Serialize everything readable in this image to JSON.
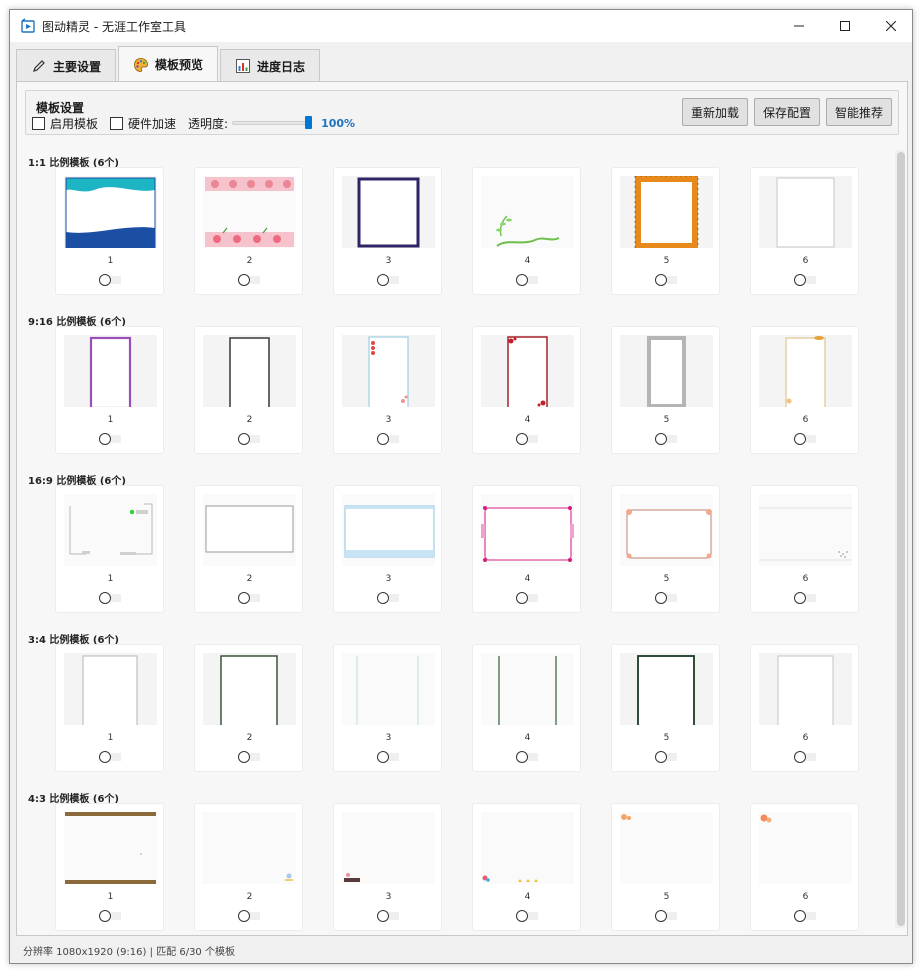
{
  "window": {
    "title": "图动精灵 - 无涯工作室工具"
  },
  "tabs": [
    {
      "label": "主要设置",
      "icon": "pen-icon",
      "active": false
    },
    {
      "label": "模板预览",
      "icon": "palette-icon",
      "active": true
    },
    {
      "label": "进度日志",
      "icon": "bar-chart-icon",
      "active": false
    }
  ],
  "settings": {
    "group_label": "模板设置",
    "enable_template_label": "启用模板",
    "hw_accel_label": "硬件加速",
    "opacity_label": "透明度:",
    "opacity_value": "100%",
    "opacity_level": 1.0,
    "buttons": {
      "reload": "重新加载",
      "save": "保存配置",
      "recommend": "智能推荐"
    }
  },
  "accent_color": "#0078d7",
  "sections": [
    {
      "title": "1:1 比例模板 (6个)",
      "ratio": "1:1",
      "items": [
        "1",
        "2",
        "3",
        "4",
        "5",
        "6"
      ]
    },
    {
      "title": "9:16 比例模板 (6个)",
      "ratio": "9:16",
      "items": [
        "1",
        "2",
        "3",
        "4",
        "5",
        "6"
      ]
    },
    {
      "title": "16:9 比例模板 (6个)",
      "ratio": "16:9",
      "items": [
        "1",
        "2",
        "3",
        "4",
        "5",
        "6"
      ]
    },
    {
      "title": "3:4 比例模板 (6个)",
      "ratio": "3:4",
      "items": [
        "1",
        "2",
        "3",
        "4",
        "5",
        "6"
      ]
    },
    {
      "title": "4:3 比例模板 (6个)",
      "ratio": "4:3",
      "items": [
        "1",
        "2",
        "3",
        "4",
        "5",
        "6"
      ]
    }
  ],
  "status": {
    "text": "分辨率 1080x1920 (9:16) | 匹配 6/30 个模板"
  }
}
